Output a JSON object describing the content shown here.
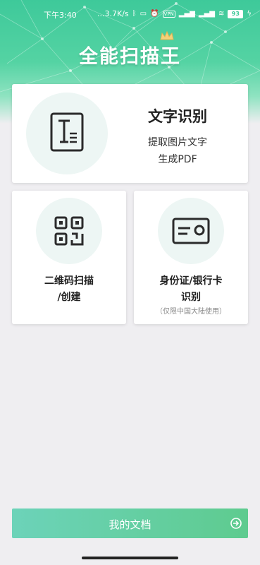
{
  "status_bar": {
    "time": "下午3:40",
    "net_speed": "...3.7K/s",
    "icons": [
      "bluetooth-icon",
      "vibrate-icon",
      "alarm-off-icon",
      "vpn-icon",
      "signal-hd-icon",
      "signal-hd-icon",
      "wifi-icon"
    ],
    "vpn_label": "VPN",
    "battery": "93"
  },
  "app": {
    "title": "全能扫描王"
  },
  "cards": {
    "text_recognition": {
      "title": "文字识别",
      "line1": "提取图片文字",
      "line2": "生成PDF",
      "icon": "document-text-icon"
    },
    "qr": {
      "title_line1": "二维码扫描",
      "title_line2": "/创建",
      "icon": "qr-code-icon"
    },
    "id_card": {
      "title_line1": "身份证/银行卡",
      "title_line2": "识别",
      "note": "（仅限中国大陆使用）",
      "icon": "id-card-icon"
    }
  },
  "bottom": {
    "label": "我的文档",
    "icon": "arrow-right-circle-icon"
  },
  "colors": {
    "accent": "#4fcf9c",
    "text": "#222222"
  }
}
